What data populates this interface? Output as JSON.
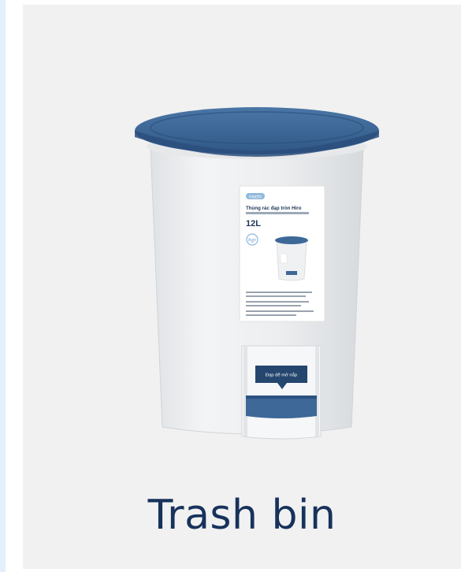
{
  "product": {
    "caption": "Trash bin",
    "image_alt": "Trash bin",
    "label": {
      "brand": "inochi",
      "name": "Thùng rác đạp tròn Hiro",
      "capacity": "12L",
      "badge": "Ag+",
      "pedal_tag": "Đạp để mở nắp"
    },
    "colors": {
      "lid": "#3d6898",
      "body": "#eef0f1",
      "caption": "#17325b",
      "background": "#f1f1f1"
    }
  }
}
